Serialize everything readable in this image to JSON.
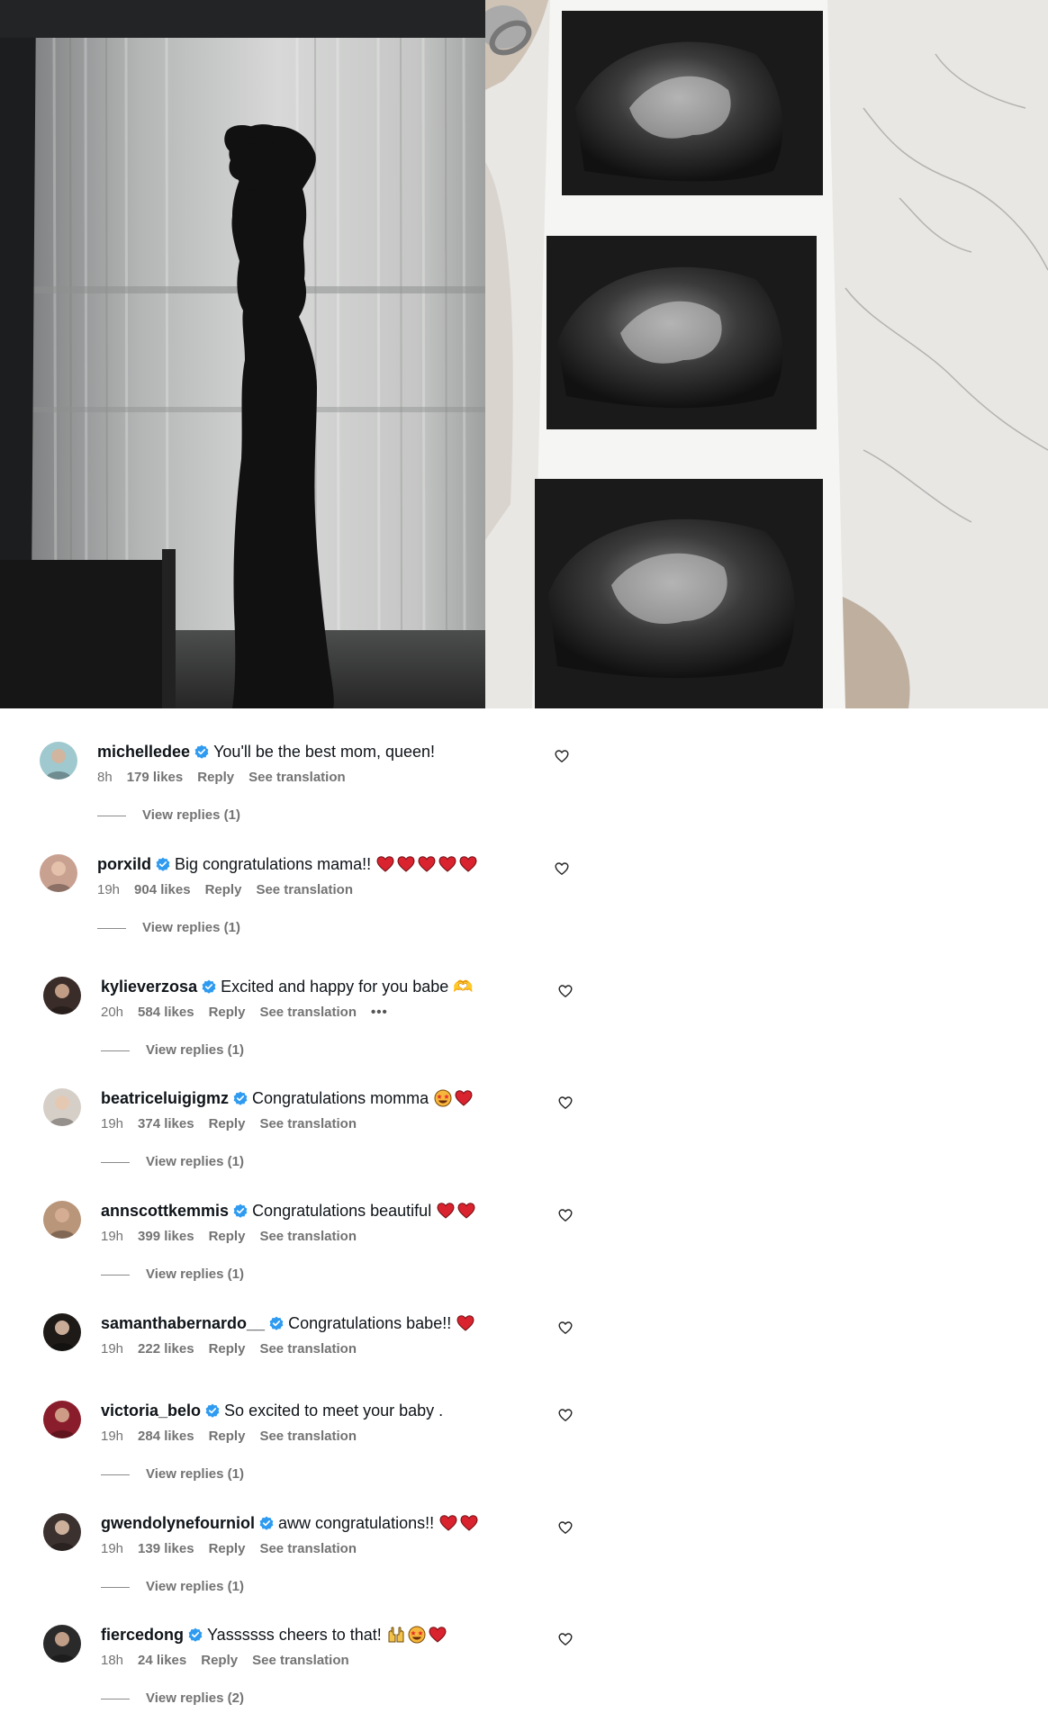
{
  "comments": [
    {
      "username": "michelledee",
      "text": "You'll be the best mom, queen!",
      "time": "8h",
      "likes": "179 likes",
      "reply": "Reply",
      "translate": "See translation",
      "replies": "View replies (1)",
      "reactions": [],
      "avatar_color": "#9fc9cf"
    },
    {
      "username": "porxild",
      "text": "Big congratulations mama!!",
      "time": "19h",
      "likes": "904 likes",
      "reply": "Reply",
      "translate": "See translation",
      "replies": "View replies (1)",
      "reactions": [
        "heart",
        "heart",
        "heart",
        "heart",
        "heart"
      ],
      "avatar_color": "#c9a191"
    },
    {
      "username": "kylieverzosa",
      "text": "Excited and happy for you babe 🫶",
      "time": "20h",
      "likes": "584 likes",
      "reply": "Reply",
      "translate": "See translation",
      "more": "•••",
      "replies": "View replies (1)",
      "reactions": [],
      "avatar_color": "#3a2c28"
    },
    {
      "username": "beatriceluigigmz",
      "text": "Congratulations momma",
      "time": "19h",
      "likes": "374 likes",
      "reply": "Reply",
      "translate": "See translation",
      "replies": "View replies (1)",
      "reactions": [
        "star-eyes",
        "heart"
      ],
      "avatar_color": "#d6cfc8"
    },
    {
      "username": "annscottkemmis",
      "text": "Congratulations beautiful",
      "time": "19h",
      "likes": "399 likes",
      "reply": "Reply",
      "translate": "See translation",
      "replies": "View replies (1)",
      "reactions": [
        "heart",
        "heart"
      ],
      "avatar_color": "#b99579"
    },
    {
      "username": "samanthabernardo__",
      "text": "Congratulations babe!!",
      "time": "19h",
      "likes": "222 likes",
      "reply": "Reply",
      "translate": "See translation",
      "replies": "",
      "reactions": [
        "heart"
      ],
      "avatar_color": "#1e1a18"
    },
    {
      "username": "victoria_belo",
      "text": "So excited to meet your baby .",
      "time": "19h",
      "likes": "284 likes",
      "reply": "Reply",
      "translate": "See translation",
      "replies": "View replies (1)",
      "reactions": [],
      "avatar_color": "#8a1d2b"
    },
    {
      "username": "gwendolynefourniol",
      "text": "aww congratulations!!",
      "time": "19h",
      "likes": "139 likes",
      "reply": "Reply",
      "translate": "See translation",
      "replies": "View replies (1)",
      "reactions": [
        "heart",
        "heart"
      ],
      "avatar_color": "#3b3230"
    },
    {
      "username": "fiercedong",
      "text": "Yassssss cheers to that!",
      "time": "18h",
      "likes": "24 likes",
      "reply": "Reply",
      "translate": "See translation",
      "replies": "View replies (2)",
      "reactions": [
        "raising-hands",
        "star-eyes",
        "heart"
      ],
      "avatar_color": "#2a2a2a"
    }
  ],
  "colors": {
    "verified": "#2f9bf0",
    "heart_red": "#d9232e",
    "muted_text": "#737373"
  }
}
